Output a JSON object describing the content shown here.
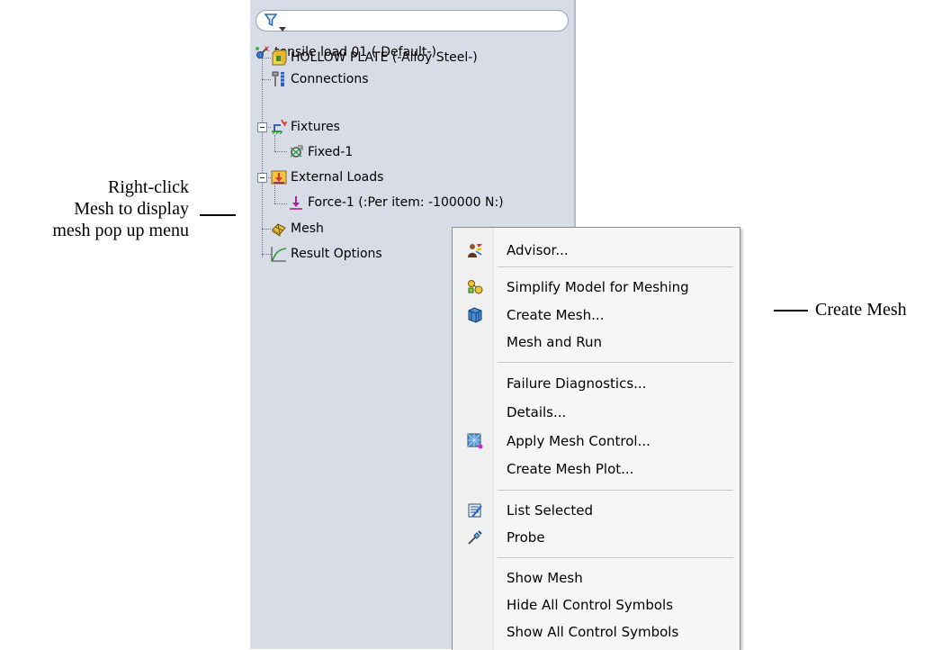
{
  "callouts": {
    "left_line1": "Right-click",
    "left_line2": "Mesh to display",
    "left_line3": "mesh pop up menu",
    "right": "Create Mesh"
  },
  "tree": {
    "root": "tensile load 01 (-Default-)",
    "part": "HOLLOW PLATE (-Alloy Steel-)",
    "connections": "Connections",
    "fixtures": "Fixtures",
    "fixed": "Fixed-1",
    "external_loads": "External Loads",
    "force": "Force-1 (:Per item: -100000 N:)",
    "mesh": "Mesh",
    "result_options": "Result Options"
  },
  "menu": {
    "advisor": "Advisor...",
    "simplify": "Simplify Model for Meshing",
    "create_mesh": "Create Mesh...",
    "mesh_and_run": "Mesh and Run",
    "failure_diagnostics": "Failure Diagnostics...",
    "details": "Details...",
    "apply_mesh_control": "Apply Mesh Control...",
    "create_mesh_plot": "Create Mesh Plot...",
    "list_selected": "List Selected",
    "probe": "Probe",
    "show_mesh": "Show Mesh",
    "hide_all": "Hide All Control Symbols",
    "show_all": "Show All Control Symbols"
  },
  "colors": {
    "panel_bg": "#d8dce6",
    "menu_bg": "#f6f6f6",
    "filter_icon": "#2f6fb0"
  },
  "icons": [
    "filter-icon",
    "study-icon",
    "part-icon",
    "connections-icon",
    "fixtures-icon",
    "fixed-icon",
    "external-loads-icon",
    "force-icon",
    "mesh-icon",
    "result-options-icon",
    "advisor-icon",
    "simplify-icon",
    "create-mesh-icon",
    "mesh-control-icon",
    "list-selected-icon",
    "probe-icon"
  ]
}
